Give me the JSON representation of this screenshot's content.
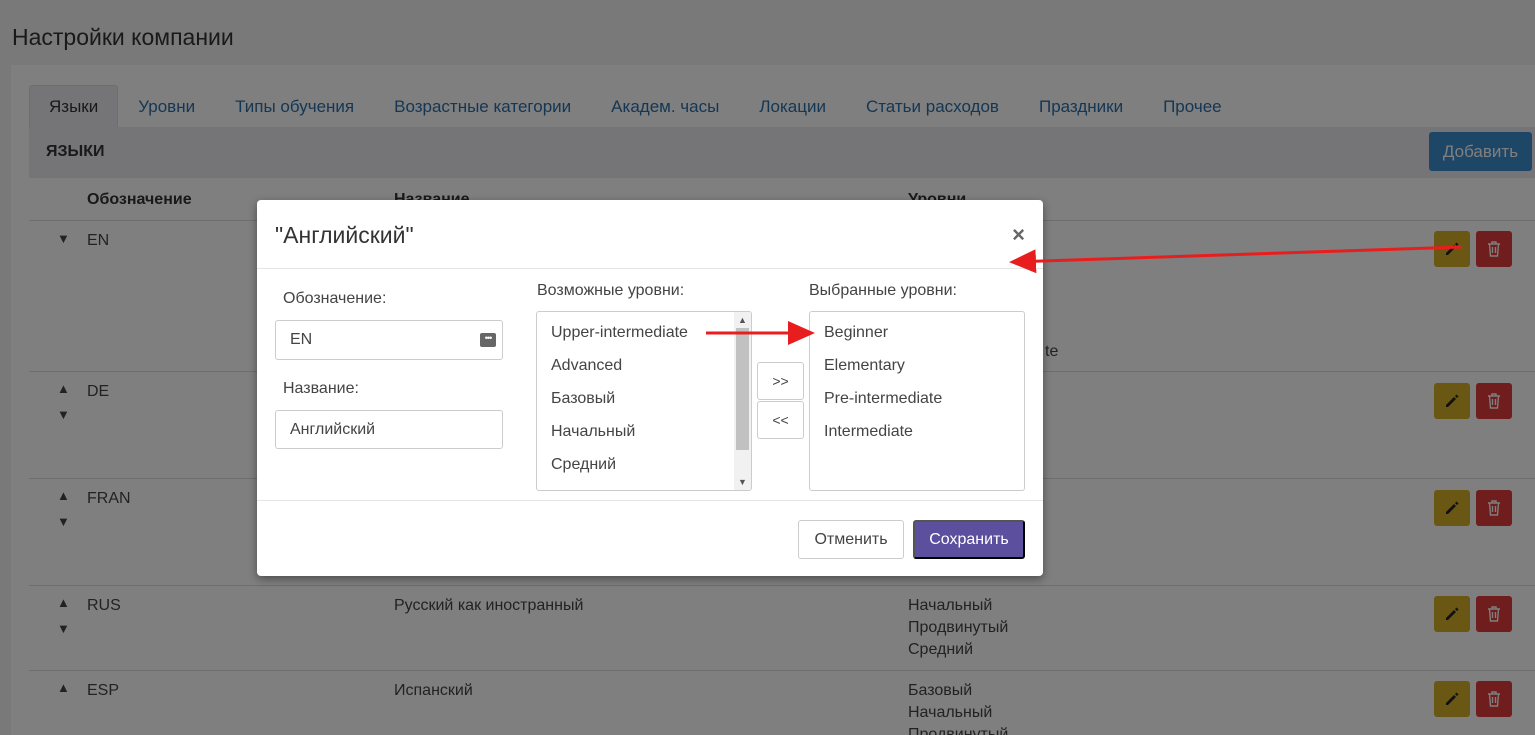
{
  "page": {
    "title": "Настройки компании"
  },
  "tabs": [
    {
      "label": "Языки"
    },
    {
      "label": "Уровни"
    },
    {
      "label": "Типы обучения"
    },
    {
      "label": "Возрастные категории"
    },
    {
      "label": "Академ. часы"
    },
    {
      "label": "Локации"
    },
    {
      "label": "Статьи расходов"
    },
    {
      "label": "Праздники"
    },
    {
      "label": "Прочее"
    }
  ],
  "section": {
    "title": "ЯЗЫКИ",
    "add_label": "Добавить"
  },
  "table": {
    "headers": {
      "code": "Обозначение",
      "name": "Название",
      "levels": "Уровни"
    },
    "rows": [
      {
        "code": "EN",
        "name": "",
        "levels": [],
        "levels_tail": "te"
      },
      {
        "code": "DE",
        "name": "",
        "levels": []
      },
      {
        "code": "FRAN",
        "name": "",
        "levels": []
      },
      {
        "code": "RUS",
        "name": "Русский как иностранный",
        "levels": [
          "Начальный",
          "Продвинутый",
          "Средний"
        ]
      },
      {
        "code": "ESP",
        "name": "Испанский",
        "levels": [
          "Базовый",
          "Начальный",
          "Продвинутый"
        ]
      }
    ],
    "arrow_up": "▲",
    "arrow_down": "▼"
  },
  "modal": {
    "title": "\"Английский\"",
    "close": "×",
    "code_label": "Обозначение:",
    "code_value": "EN",
    "name_label": "Название:",
    "name_value": "Английский",
    "available_label": "Возможные уровни:",
    "available": [
      "Upper-intermediate",
      "Advanced",
      "Базовый",
      "Начальный",
      "Средний"
    ],
    "selected_label": "Выбранные уровни:",
    "selected": [
      "Beginner",
      "Elementary",
      "Pre-intermediate",
      "Intermediate"
    ],
    "move_right": ">>",
    "move_left": "<<",
    "cancel": "Отменить",
    "save": "Сохранить"
  },
  "colors": {
    "primary": "#3c8dcc",
    "edit": "#d7ae28",
    "delete": "#de3b3b",
    "save": "#5c4f9e",
    "annotation_arrow": "#e81e1e"
  }
}
